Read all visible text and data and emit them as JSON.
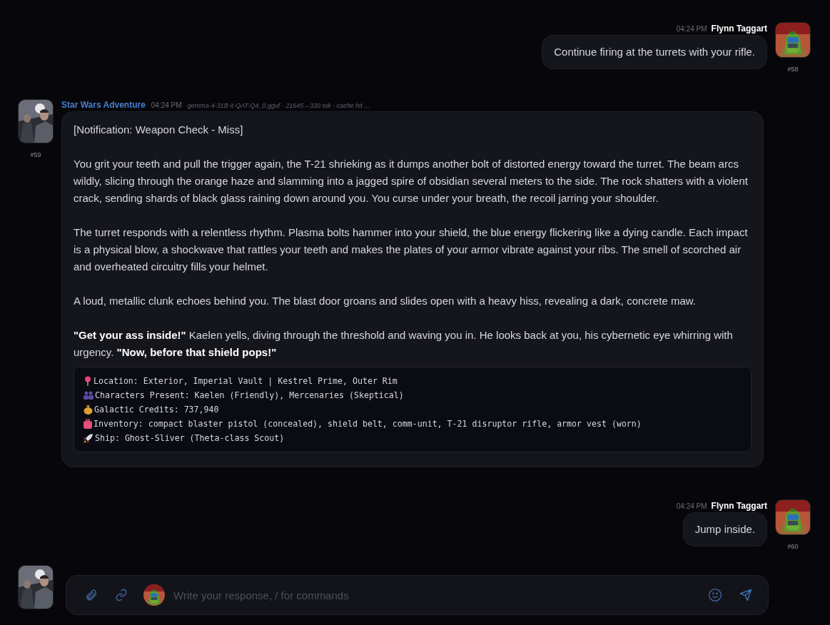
{
  "messages": [
    {
      "kind": "user",
      "author": "Flynn Taggart",
      "time": "04:24 PM",
      "number": "#58",
      "paragraphs": [
        "Continue firing at the turrets with your rifle."
      ]
    },
    {
      "kind": "bot",
      "author": "Star Wars Adventure",
      "time": "04:24 PM",
      "meta": "gemma-4-31B-it-QAT-Q4_0.gguf · 21645→330 tok · cache hit ...",
      "number": "#59",
      "paragraphs": [
        "[Notification: Weapon Check - Miss]",
        "You grit your teeth and pull the trigger again, the T-21 shrieking as it dumps another bolt of distorted energy toward the turret. The beam arcs wildly, slicing through the orange haze and slamming into a jagged spire of obsidian several meters to the side. The rock shatters with a violent crack, sending shards of black glass raining down around you. You curse under your breath, the recoil jarring your shoulder.",
        "The turret responds with a relentless rhythm. Plasma bolts hammer into your shield, the blue energy flickering like a dying candle. Each impact is a physical blow, a shockwave that rattles your teeth and makes the plates of your armor vibrate against your ribs. The smell of scorched air and overheated circuitry fills your helmet.",
        "A loud, metallic clunk echoes behind you. The blast door groans and slides open with a heavy hiss, revealing a dark, concrete maw.",
        "**\"Get your ass inside!\"** Kaelen yells, diving through the threshold and waving you in. He looks back at you, his cybernetic eye whirring with urgency. **\"Now, before that shield pops!\"**"
      ],
      "status": [
        "Location: Exterior, Imperial Vault | Kestrel Prime, Outer Rim",
        "Characters Present: Kaelen (Friendly), Mercenaries (Skeptical)",
        "Galactic Credits: 737,940",
        "Inventory: compact blaster pistol (concealed), shield belt, comm-unit, T-21 disruptor rifle, armor vest (worn)",
        "Ship: Ghost-Sliver (Theta-class Scout)"
      ]
    },
    {
      "kind": "user",
      "author": "Flynn Taggart",
      "time": "04:24 PM",
      "number": "#60",
      "paragraphs": [
        "Jump inside."
      ]
    },
    {
      "kind": "bot-hidden"
    }
  ],
  "composer": {
    "placeholder": "Write your response, / for commands"
  }
}
